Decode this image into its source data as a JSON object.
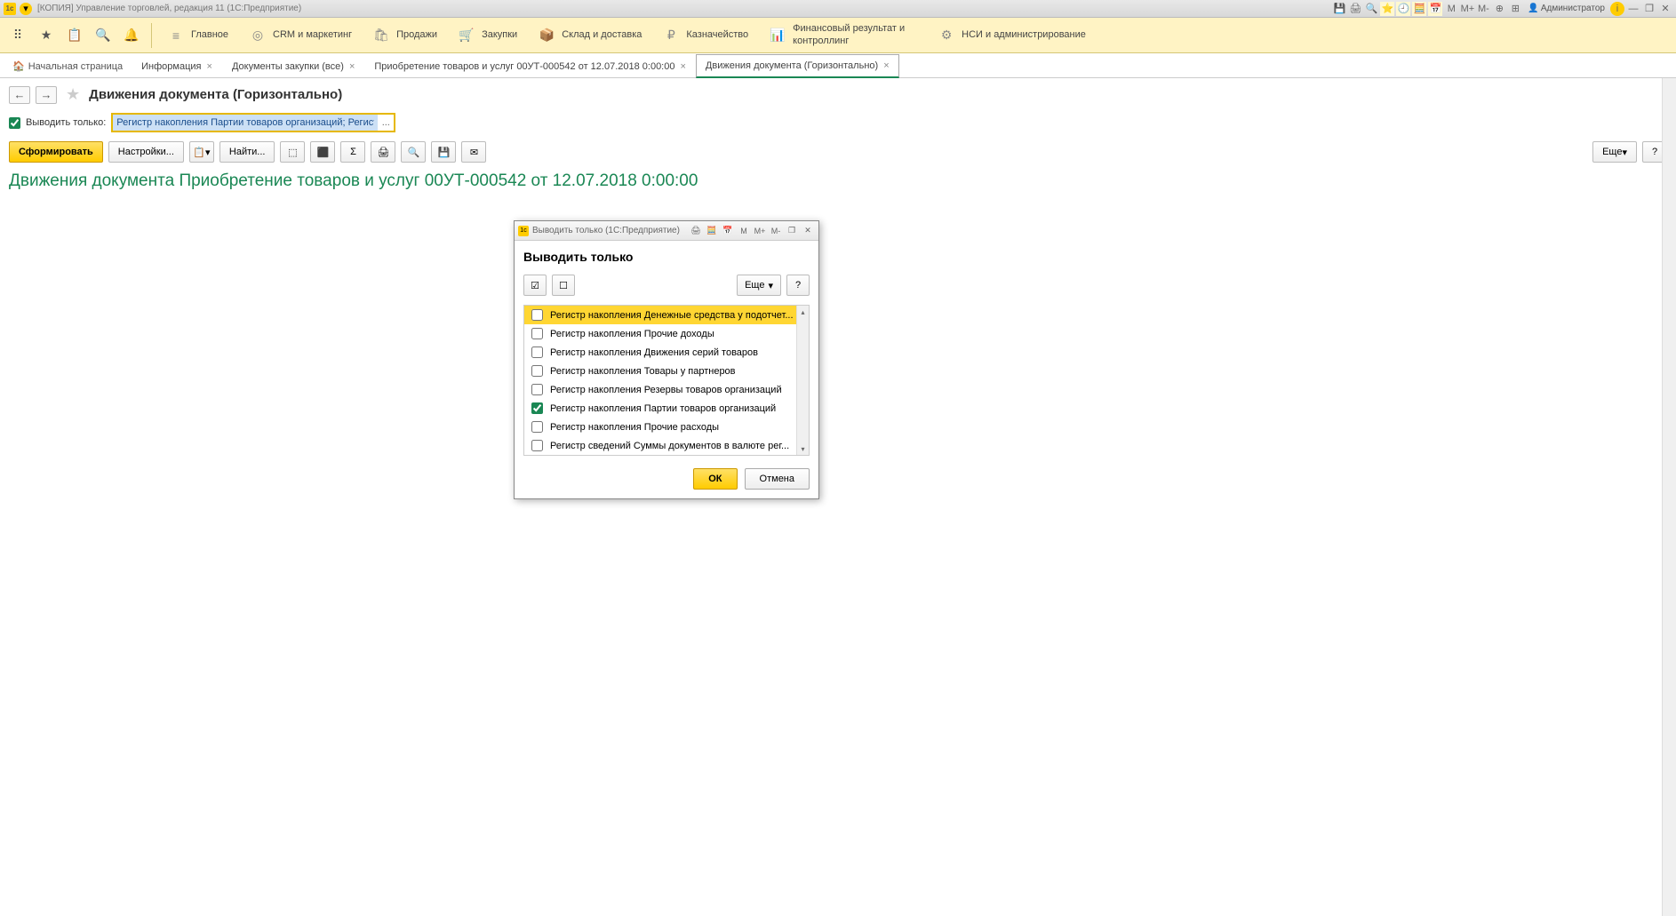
{
  "titlebar": {
    "title": "[КОПИЯ] Управление торговлей, редакция 11  (1С:Предприятие)",
    "user": "Администратор"
  },
  "mainmenu": {
    "sections": [
      {
        "label": "Главное"
      },
      {
        "label": "CRM и маркетинг"
      },
      {
        "label": "Продажи"
      },
      {
        "label": "Закупки"
      },
      {
        "label": "Склад и доставка"
      },
      {
        "label": "Казначейство"
      },
      {
        "label": "Финансовый результат и контроллинг"
      },
      {
        "label": "НСИ и администрирование"
      }
    ]
  },
  "tabs": {
    "home": "Начальная страница",
    "items": [
      {
        "label": "Информация"
      },
      {
        "label": "Документы закупки (все)"
      },
      {
        "label": "Приобретение товаров и услуг 00УТ-000542 от 12.07.2018 0:00:00"
      },
      {
        "label": "Движения документа (Горизонтально)"
      }
    ]
  },
  "page": {
    "title": "Движения документа (Горизонтально)",
    "filter_label": "Выводить только:",
    "filter_value": "Регистр накопления Партии товаров организаций; Регистр накоп",
    "btn_form": "Сформировать",
    "btn_settings": "Настройки...",
    "btn_find": "Найти...",
    "btn_more": "Еще",
    "report_title": "Движения документа Приобретение товаров и услуг 00УТ-000542 от 12.07.2018 0:00:00"
  },
  "modal": {
    "wintitle": "Выводить только  (1С:Предприятие)",
    "heading": "Выводить только",
    "btn_more": "Еще",
    "items": [
      {
        "label": "Регистр накопления Денежные средства у подотчет...",
        "checked": false
      },
      {
        "label": "Регистр накопления Прочие доходы",
        "checked": false
      },
      {
        "label": "Регистр накопления Движения серий товаров",
        "checked": false
      },
      {
        "label": "Регистр накопления Товары у партнеров",
        "checked": false
      },
      {
        "label": "Регистр накопления Резервы товаров организаций",
        "checked": false
      },
      {
        "label": "Регистр накопления Партии товаров организаций",
        "checked": true
      },
      {
        "label": "Регистр накопления Прочие расходы",
        "checked": false
      },
      {
        "label": "Регистр сведений Суммы документов в валюте рег...",
        "checked": false
      }
    ],
    "btn_ok": "ОК",
    "btn_cancel": "Отмена"
  }
}
